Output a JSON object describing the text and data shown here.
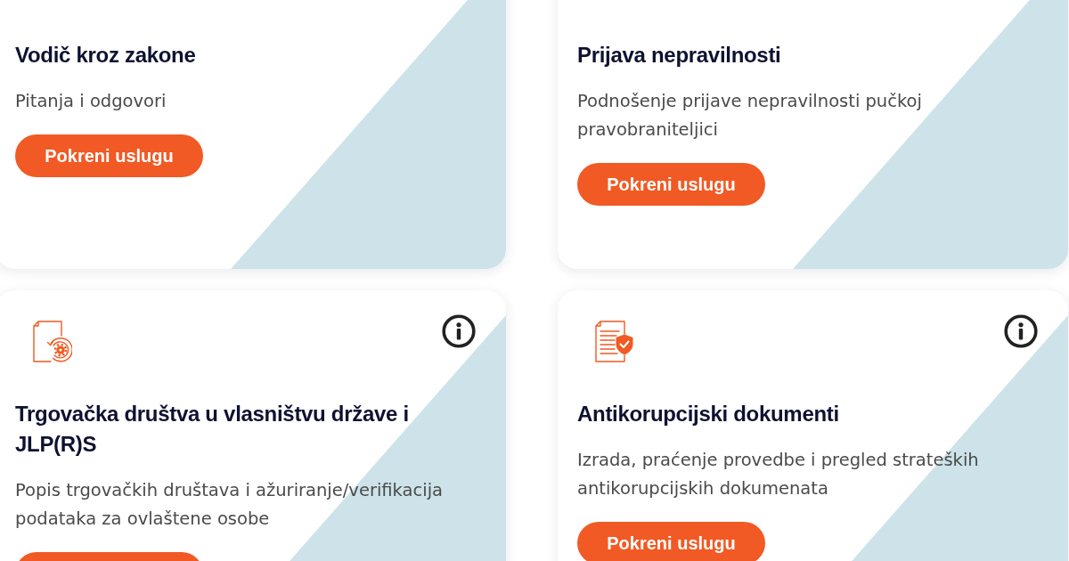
{
  "cards": [
    {
      "title": "Vodič kroz zakone",
      "description": "Pitanja i odgovori",
      "has_button": true,
      "button_label": "Pokreni uslugu"
    },
    {
      "title": "Prijava nepravilnosti",
      "description": "Podnošenje prijave nepravilnosti pučkoj pravobraniteljici",
      "has_button": true,
      "button_label": "Pokreni uslugu"
    },
    {
      "kind": "document-gear",
      "info_button": true,
      "title": "Trgovačka društva u vlasništvu države i JLP(R)S",
      "description": "Popis trgovačkih društava i ažuriranje/verifikacija podataka za ovlaštene osobe",
      "has_button": true
    },
    {
      "kind": "document-shield",
      "info_button": true,
      "title": "Antikorupcijski dokumenti",
      "description": "Izrada, praćenje provedbe i pregled strateških antikorupcijskih dokumenata",
      "has_button": true,
      "button_label": "Pokreni uslugu"
    }
  ]
}
